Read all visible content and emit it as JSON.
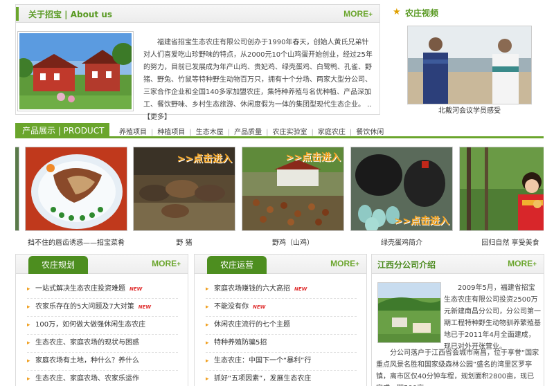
{
  "about": {
    "title": "关于招宝 | About us",
    "more": "MORE",
    "text": "福建省招宝生态农庄有限公司创办于1990年春天，创始人黄氏兄弟针对人们喜爱吃山珍野味的特点，从2000元10个山鸡蛋开始创业，经过25年的努力，目前已发展成为年产山鸡、贵妃鸡、绿壳蛋鸡、白鹭鸭、孔雀、野猪、野兔、竹鼠等特种野生动物百万只，拥有十个分场、两家大型分公司、三家合作企业和全国140多家加盟农庄，集特种养殖与名优种植、产品深加工、餐饮野味、乡村生态旅游、休闲度假为一体的集团型现代生态企业。",
    "read_more": "..【更多】"
  },
  "video": {
    "title": "农庄视频",
    "caption": "北戴河会议学员感受"
  },
  "products": {
    "tab": "产品展示 | PRODUCT",
    "nav": [
      "养殖项目",
      "种植项目",
      "生态木屋",
      "产品质量",
      "农庄实验室",
      "家庭农庄",
      "餐饮休闲"
    ],
    "enter_label": ">>点击进入",
    "items": [
      {
        "caption": "挡不住的唇齿诱惑——招宝菜肴"
      },
      {
        "caption": "野 猪"
      },
      {
        "caption": "野鸡（山鸡）"
      },
      {
        "caption": "绿壳蛋鸡简介"
      },
      {
        "caption": "回归自然 享受美食"
      }
    ]
  },
  "planning": {
    "title": "农庄规划",
    "more": "MORE",
    "items": [
      {
        "text": "一站式解决生态农庄投资难题",
        "badge": "NEW"
      },
      {
        "text": "农家乐存在的5大问题及7大对策",
        "badge": "NEW"
      },
      {
        "text": "100万，如何做大做强休闲生态农庄",
        "badge": ""
      },
      {
        "text": "生态农庄、家庭农场的现状与困惑",
        "badge": ""
      },
      {
        "text": "家庭农场有土地，种什么？养什么",
        "badge": ""
      },
      {
        "text": "生态农庄、家庭农场、农家乐运作",
        "badge": ""
      }
    ]
  },
  "operation": {
    "title": "农庄运营",
    "more": "MORE",
    "items": [
      {
        "text": "家庭农场赚钱的六大高招",
        "badge": "NEW"
      },
      {
        "text": "不能没有你",
        "badge": "NEW"
      },
      {
        "text": "休闲农庄流行的七个主题",
        "badge": ""
      },
      {
        "text": "特种养殖防骗5招",
        "badge": ""
      },
      {
        "text": "生态农庄：中国下一个“暴利”行",
        "badge": ""
      },
      {
        "text": "抓好“五项因素”，发展生态农庄",
        "badge": ""
      }
    ]
  },
  "jiangxi": {
    "title": "江西分公司介绍",
    "more": "MORE",
    "text1": "2009年5月，福建省招宝生态农庄有限公司投资2500万元新建南昌分公司，分公司第一期工程特种野生动物驯养繁殖基地已于2011年4月全面建成，现已对外开张营业。",
    "text2": "分公司落户于江西省会城市南昌，位于享誉“国家重点风景名胜和国家级森林公园”盛名的湾里区罗亭镇，离市区仅40分钟车程，规划面积2800亩，现已完成一期500亩"
  },
  "colors": {
    "accent": "#6aa52c",
    "tab_dark": "#4d8e1f",
    "orange": "#f2a11d",
    "new_badge": "#e03030"
  }
}
